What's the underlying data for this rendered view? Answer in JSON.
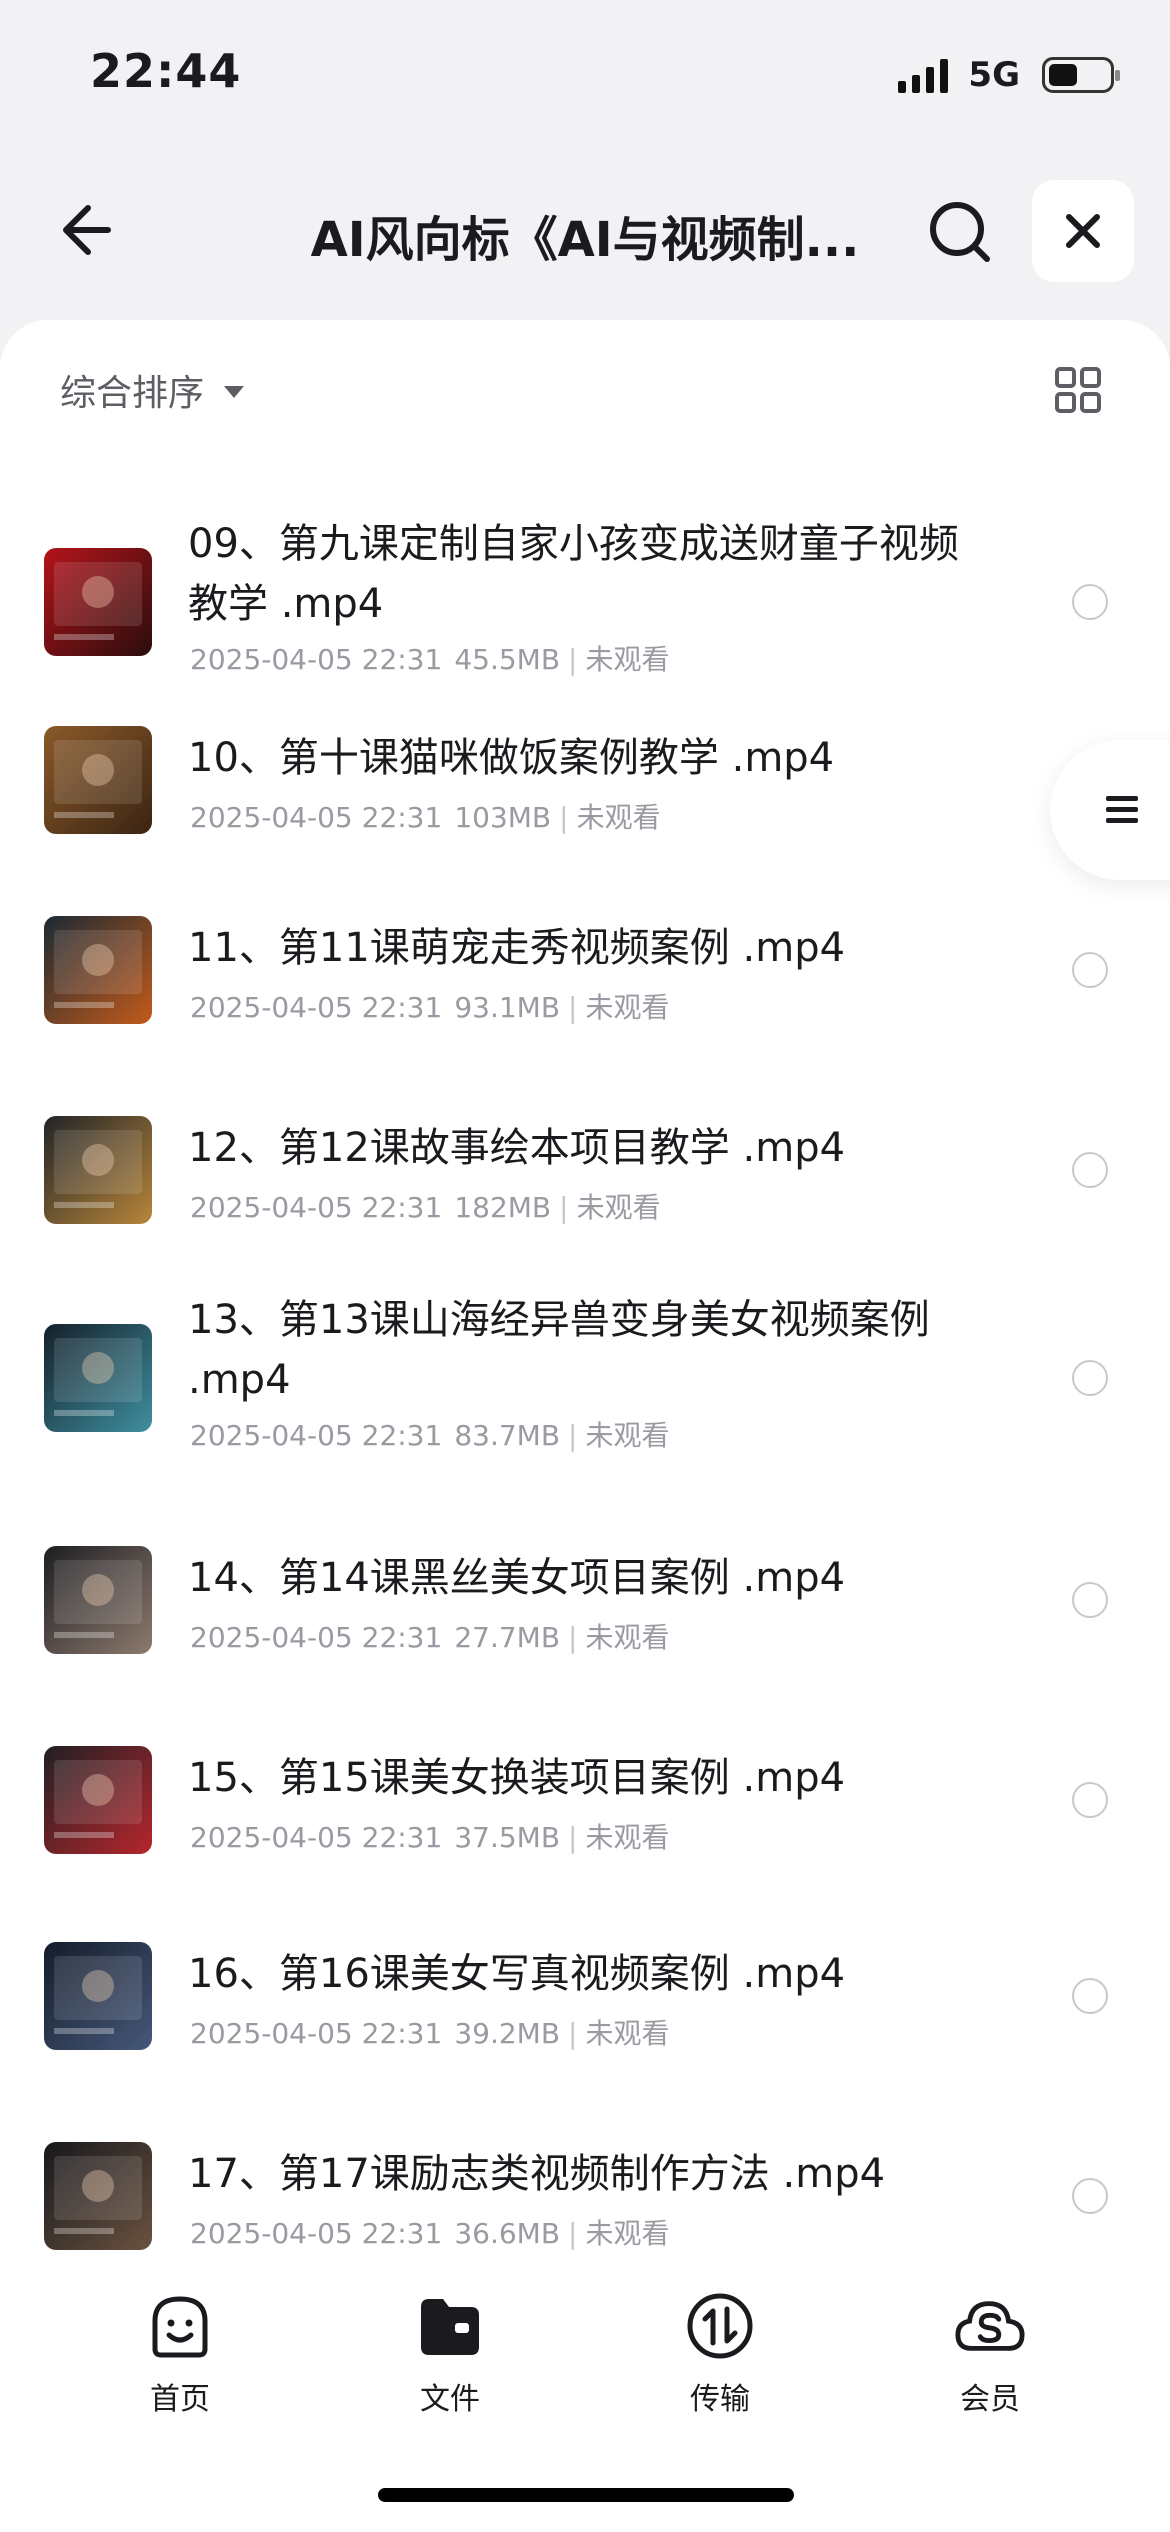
{
  "status_bar": {
    "time": "22:44",
    "network": "5G",
    "icons": [
      "signal-icon",
      "battery-icon"
    ]
  },
  "header": {
    "title": "AI风向标《AI与视频制...",
    "icons": {
      "back": "arrow-left-icon",
      "search": "search-icon",
      "close": "close-icon"
    }
  },
  "toolbar": {
    "sort_label": "综合排序",
    "sort_icon": "caret-down-icon",
    "view_icon": "grid-view-icon"
  },
  "float_menu": {
    "icon": "menu-icon"
  },
  "files": [
    {
      "name": "09、第九课定制自家小孩变成送财童子视频教学 .mp4",
      "date": "2025-04-05 22:31",
      "size": "45.5MB",
      "status": "未观看",
      "thumb_colors": [
        "#b3141a",
        "#2b0d0d"
      ]
    },
    {
      "name": "10、第十课猫咪做饭案例教学 .mp4",
      "date": "2025-04-05 22:31",
      "size": "103MB",
      "status": "未观看",
      "thumb_colors": [
        "#8a5a2a",
        "#3b2412"
      ]
    },
    {
      "name": "11、第11课萌宠走秀视频案例 .mp4",
      "date": "2025-04-05 22:31",
      "size": "93.1MB",
      "status": "未观看",
      "thumb_colors": [
        "#1c2a33",
        "#c25a1a"
      ]
    },
    {
      "name": "12、第12课故事绘本项目教学 .mp4",
      "date": "2025-04-05 22:31",
      "size": "182MB",
      "status": "未观看",
      "thumb_colors": [
        "#222428",
        "#b8863a"
      ]
    },
    {
      "name": "13、第13课山海经异兽变身美女视频案例 .mp4",
      "date": "2025-04-05 22:31",
      "size": "83.7MB",
      "status": "未观看",
      "thumb_colors": [
        "#14202a",
        "#3f8fa0"
      ]
    },
    {
      "name": "14、第14课黑丝美女项目案例 .mp4",
      "date": "2025-04-05 22:31",
      "size": "27.7MB",
      "status": "未观看",
      "thumb_colors": [
        "#1e1e22",
        "#8d7a6e"
      ]
    },
    {
      "name": "15、第15课美女换装项目案例 .mp4",
      "date": "2025-04-05 22:31",
      "size": "37.5MB",
      "status": "未观看",
      "thumb_colors": [
        "#202024",
        "#b5262c"
      ]
    },
    {
      "name": "16、第16课美女写真视频案例 .mp4",
      "date": "2025-04-05 22:31",
      "size": "39.2MB",
      "status": "未观看",
      "thumb_colors": [
        "#141c2a",
        "#46587a"
      ]
    },
    {
      "name": "17、第17课励志类视频制作方法 .mp4",
      "date": "2025-04-05 22:31",
      "size": "36.6MB",
      "status": "未观看",
      "thumb_colors": [
        "#18181c",
        "#6a5240"
      ]
    }
  ],
  "tabs": [
    {
      "label": "首页",
      "icon": "smile-face-icon"
    },
    {
      "label": "文件",
      "icon": "folder-icon"
    },
    {
      "label": "传输",
      "icon": "transfer-icon"
    },
    {
      "label": "会员",
      "icon": "cloud-s-icon"
    }
  ]
}
